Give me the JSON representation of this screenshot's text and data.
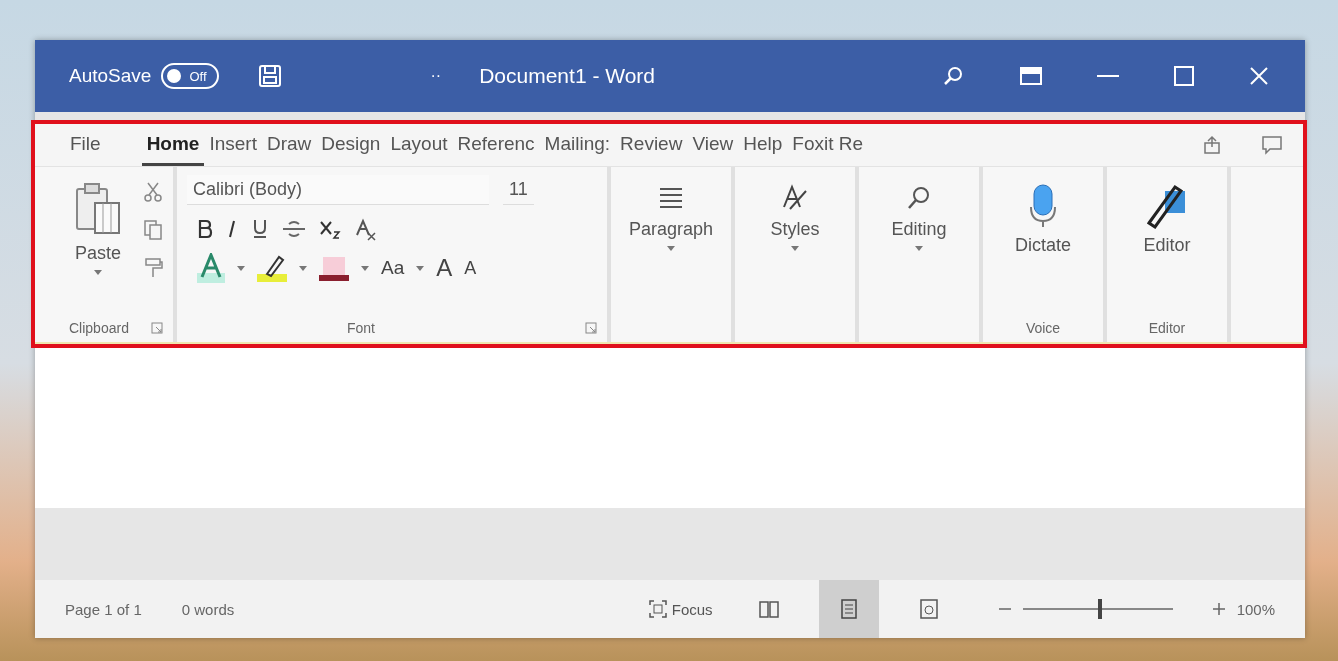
{
  "window": {
    "autosave_label": "AutoSave",
    "autosave_toggle": {
      "label": "Off",
      "on": false
    },
    "title": "Document1 - Word",
    "overflow": "··"
  },
  "tabs": [
    {
      "label": "File",
      "selected": false
    },
    {
      "label": "Home",
      "selected": true
    },
    {
      "label": "Insert",
      "selected": false
    },
    {
      "label": "Draw",
      "selected": false
    },
    {
      "label": "Design",
      "selected": false
    },
    {
      "label": "Layout",
      "selected": false
    },
    {
      "label": "Referenc",
      "selected": false
    },
    {
      "label": "Mailing:",
      "selected": false
    },
    {
      "label": "Review",
      "selected": false
    },
    {
      "label": "View",
      "selected": false
    },
    {
      "label": "Help",
      "selected": false
    },
    {
      "label": "Foxit Re",
      "selected": false
    }
  ],
  "ribbon": {
    "clipboard": {
      "paste": "Paste",
      "label": "Clipboard"
    },
    "font": {
      "name": "Calibri (Body)",
      "size": "11",
      "change_case": "Aa",
      "grow": "A",
      "shrink": "A",
      "label": "Font"
    },
    "groups": [
      {
        "kind": "paragraph",
        "label": "Paragraph"
      },
      {
        "kind": "styles",
        "label": "Styles"
      },
      {
        "kind": "editing",
        "label": "Editing"
      }
    ],
    "voice": {
      "button": "Dictate",
      "label": "Voice"
    },
    "editor": {
      "button": "Editor",
      "label": "Editor"
    }
  },
  "status_bar": {
    "page": "Page 1 of 1",
    "words": "0 words",
    "focus": "Focus",
    "views": [
      {
        "kind": "read",
        "selected": false
      },
      {
        "kind": "print",
        "selected": true
      },
      {
        "kind": "web",
        "selected": false
      }
    ],
    "zoom": {
      "level": 0.5
    },
    "zoom_reading": "100%"
  }
}
